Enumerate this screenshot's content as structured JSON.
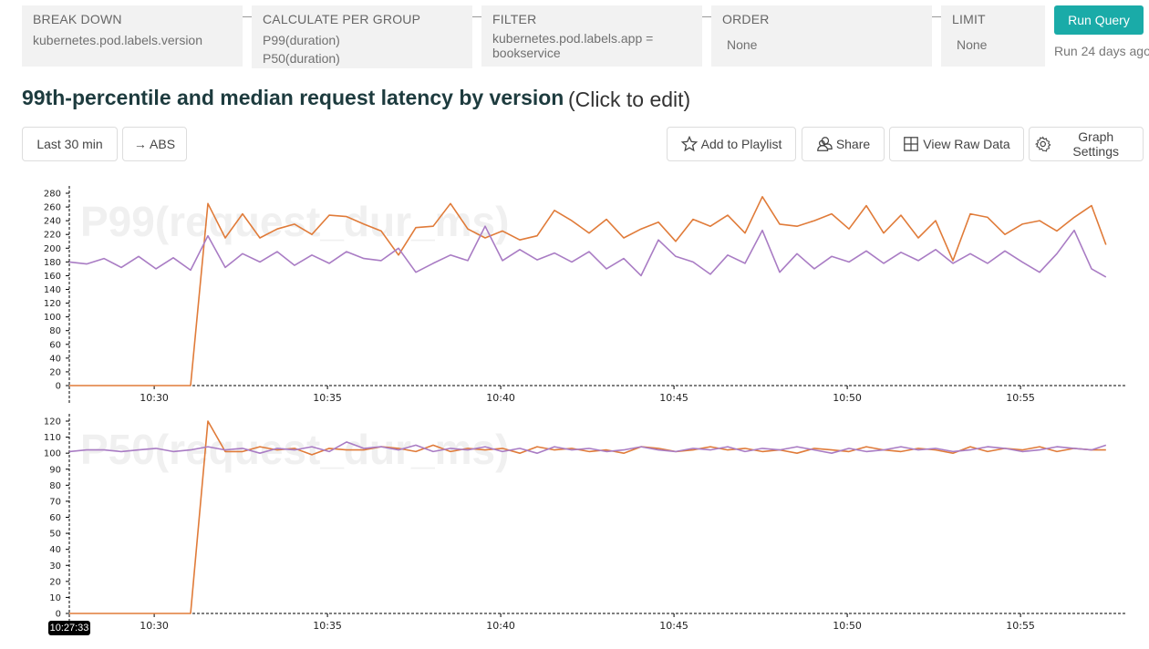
{
  "query": {
    "breakdown": {
      "label": "BREAK DOWN",
      "value": "kubernetes.pod.labels.version"
    },
    "calculate": {
      "label": "CALCULATE PER GROUP",
      "values": [
        "P99(duration)",
        "P50(duration)"
      ]
    },
    "filter": {
      "label": "FILTER",
      "values": [
        "kubernetes.pod.labels.app =",
        "bookservice"
      ]
    },
    "order": {
      "label": "ORDER",
      "value": "None"
    },
    "limit": {
      "label": "LIMIT",
      "value": "None"
    },
    "run_label": "Run Query",
    "run_status": "Run 24 days ago"
  },
  "title": "99th-percentile and median request latency by version",
  "edit_hint": "(Click to edit)",
  "toolbar": {
    "time_range": "Last 30 min",
    "abs": "→ ABS",
    "playlist": "Add to Playlist",
    "share": "Share",
    "raw": "View Raw Data",
    "settings": "Graph Settings"
  },
  "hover_time": "10:27:33",
  "colors": {
    "accent": "#1aaba8",
    "series_orange": "#e07b39",
    "series_purple": "#a97cc4"
  },
  "chart_data": [
    {
      "type": "line",
      "title": "P99(request_dur_ms)",
      "ylim": [
        0,
        280
      ],
      "yticks": [
        0,
        20,
        40,
        60,
        80,
        100,
        120,
        140,
        160,
        180,
        200,
        220,
        240,
        260,
        280
      ],
      "xticks": [
        "10:30",
        "10:35",
        "10:40",
        "10:45",
        "10:50",
        "10:55"
      ],
      "xlim": [
        "10:27:33",
        "10:58:00"
      ],
      "x": [
        "10:27:33",
        "10:28:03",
        "10:28:33",
        "10:29:03",
        "10:29:33",
        "10:30:03",
        "10:30:33",
        "10:31:03",
        "10:31:33",
        "10:32:03",
        "10:32:33",
        "10:33:03",
        "10:33:33",
        "10:34:03",
        "10:34:33",
        "10:35:03",
        "10:35:33",
        "10:36:03",
        "10:36:33",
        "10:37:03",
        "10:37:33",
        "10:38:03",
        "10:38:33",
        "10:39:03",
        "10:39:33",
        "10:40:03",
        "10:40:33",
        "10:41:03",
        "10:41:33",
        "10:42:03",
        "10:42:33",
        "10:43:03",
        "10:43:33",
        "10:44:03",
        "10:44:33",
        "10:45:03",
        "10:45:33",
        "10:46:03",
        "10:46:33",
        "10:47:03",
        "10:47:33",
        "10:48:03",
        "10:48:33",
        "10:49:03",
        "10:49:33",
        "10:50:03",
        "10:50:33",
        "10:51:03",
        "10:51:33",
        "10:52:03",
        "10:52:33",
        "10:53:03",
        "10:53:33",
        "10:54:03",
        "10:54:33",
        "10:55:03",
        "10:55:33",
        "10:56:03",
        "10:56:33",
        "10:57:03",
        "10:57:28"
      ],
      "series": [
        {
          "color": "#a97cc4",
          "values": [
            180,
            177,
            185,
            172,
            188,
            170,
            186,
            168,
            218,
            172,
            192,
            180,
            195,
            175,
            190,
            178,
            195,
            185,
            182,
            200,
            165,
            178,
            190,
            182,
            232,
            182,
            198,
            183,
            193,
            180,
            195,
            170,
            185,
            160,
            212,
            188,
            180,
            162,
            190,
            178,
            226,
            165,
            192,
            170,
            188,
            180,
            196,
            178,
            194,
            182,
            198,
            178,
            192,
            178,
            196,
            180,
            165,
            192,
            226,
            170,
            158
          ]
        },
        {
          "color": "#e07b39",
          "values": [
            0,
            0,
            0,
            0,
            0,
            0,
            0,
            0,
            265,
            215,
            250,
            215,
            228,
            235,
            220,
            248,
            246,
            235,
            225,
            190,
            230,
            232,
            265,
            228,
            215,
            225,
            212,
            218,
            255,
            240,
            222,
            242,
            215,
            228,
            238,
            210,
            242,
            232,
            248,
            222,
            275,
            235,
            232,
            240,
            250,
            228,
            262,
            222,
            248,
            215,
            240,
            182,
            250,
            245,
            220,
            235,
            240,
            225,
            245,
            262,
            205
          ]
        }
      ]
    },
    {
      "type": "line",
      "title": "P50(request_dur_ms)",
      "ylim": [
        0,
        120
      ],
      "yticks": [
        0,
        10,
        20,
        30,
        40,
        50,
        60,
        70,
        80,
        90,
        100,
        110,
        120
      ],
      "xticks": [
        "10:30",
        "10:35",
        "10:40",
        "10:45",
        "10:50",
        "10:55"
      ],
      "xlim": [
        "10:27:33",
        "10:58:00"
      ],
      "series": [
        {
          "color": "#a97cc4",
          "values": [
            101,
            102,
            102,
            101,
            102,
            103,
            101,
            102,
            104,
            102,
            103,
            100,
            103,
            102,
            104,
            101,
            107,
            103,
            104,
            102,
            105,
            101,
            103,
            102,
            104,
            101,
            103,
            100,
            104,
            102,
            103,
            101,
            102,
            104,
            102,
            101,
            103,
            102,
            104,
            101,
            103,
            102,
            104,
            102,
            100,
            103,
            101,
            102,
            104,
            102,
            103,
            101,
            102,
            104,
            103,
            101,
            102,
            104,
            103,
            102,
            105
          ]
        },
        {
          "color": "#e07b39",
          "values": [
            0,
            0,
            0,
            0,
            0,
            0,
            0,
            0,
            120,
            101,
            101,
            104,
            102,
            103,
            99,
            103,
            102,
            102,
            104,
            103,
            101,
            105,
            101,
            103,
            102,
            103,
            100,
            104,
            102,
            103,
            101,
            102,
            100,
            104,
            103,
            101,
            102,
            104,
            102,
            103,
            101,
            102,
            100,
            103,
            102,
            101,
            104,
            102,
            101,
            103,
            102,
            100,
            104,
            101,
            103,
            102,
            104,
            101,
            103,
            102,
            102
          ]
        }
      ]
    }
  ]
}
